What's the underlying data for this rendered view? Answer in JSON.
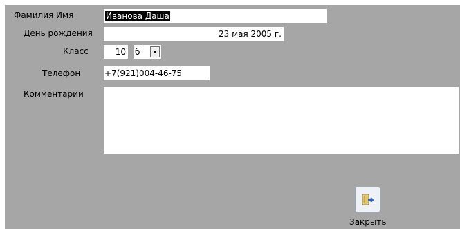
{
  "form": {
    "surname_label": "Фамилия Имя",
    "surname_value": "Иванова Даша",
    "birthday_label": "День рождения",
    "birthday_value": "23 мая 2005 г.",
    "class_label": "Класс",
    "class_number": "10",
    "class_letter": "б",
    "phone_label": "Телефон",
    "phone_value": "+7(921)004-46-75",
    "comments_label": "Комментарии",
    "comments_value": ""
  },
  "actions": {
    "close_label": "Закрыть",
    "close_icon": "exit-door-icon"
  }
}
